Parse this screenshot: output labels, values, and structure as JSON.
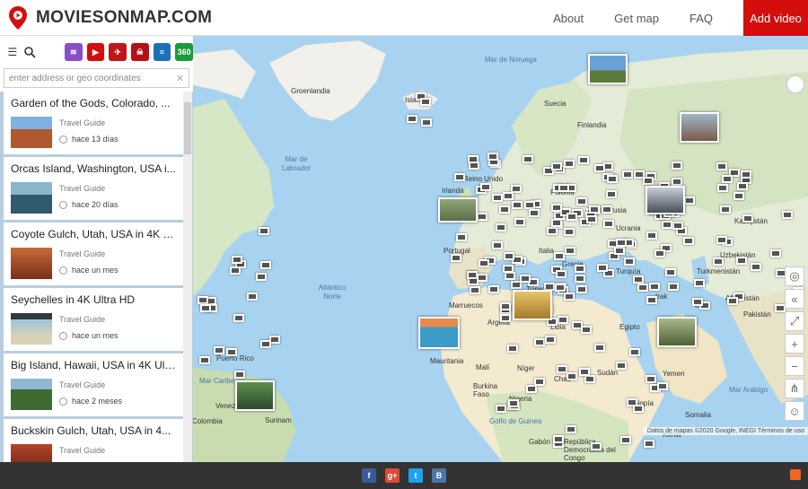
{
  "header": {
    "logo_text": "MOVIESONMAP.COM",
    "nav": [
      "About",
      "Get map",
      "FAQ"
    ],
    "add_video": "Add video",
    "accent_color": "#d40d0d"
  },
  "sidebar": {
    "search_placeholder": "enter address or geo coordinates",
    "categories": [
      {
        "icon": "layers-icon",
        "color": "#8a4fc7"
      },
      {
        "icon": "play-icon",
        "color": "#d40d0d"
      },
      {
        "icon": "drone-icon",
        "color": "#c0161b"
      },
      {
        "icon": "skull-icon",
        "color": "#b80f14"
      },
      {
        "icon": "surf-icon",
        "color": "#1f6fb5"
      },
      {
        "icon": "360-icon",
        "color": "#1a9b3c"
      }
    ],
    "items": [
      {
        "title": "Garden of the Gods, Colorado, ...",
        "category": "Travel Guide",
        "time": "hace 13 días"
      },
      {
        "title": "Orcas Island, Washington, USA i...",
        "category": "Travel Guide",
        "time": "hace 20 días"
      },
      {
        "title": "Coyote Gulch, Utah, USA in 4K U...",
        "category": "Travel Guide",
        "time": "hace un mes"
      },
      {
        "title": "Seychelles in 4K Ultra HD",
        "category": "Travel Guide",
        "time": "hace un mes"
      },
      {
        "title": "Big Island, Hawaii, USA in 4K Ult...",
        "category": "Travel Guide",
        "time": "hace 2 meses"
      },
      {
        "title": "Buckskin Gulch, Utah, USA in 4...",
        "category": "Travel Guide",
        "time": ""
      }
    ]
  },
  "map": {
    "ocean_labels": [
      {
        "text": "Mar de Noruega"
      },
      {
        "text": "Mar de Labrador"
      },
      {
        "text": "Atlántico Norte"
      },
      {
        "text": "Mar Caribe"
      },
      {
        "text": "Golfo de Guinea"
      },
      {
        "text": "Mar Arábigo"
      }
    ],
    "labels": [
      "Groenlandia",
      "Islandia",
      "Suecia",
      "Finlandia",
      "Reino Unido",
      "Irlanda",
      "Polonia",
      "Kazajistán",
      "Uzbekistán",
      "Turkmenistán",
      "Afganistán",
      "Pakistán",
      "Irán",
      "Irak",
      "Egipto",
      "Libia",
      "Argelia",
      "Marruecos",
      "Túnez",
      "Turquía",
      "Portugal",
      "Grecia",
      "Mauritania",
      "Malí",
      "Níger",
      "Chad",
      "Sudán",
      "Nigeria",
      "Burkina Faso",
      "Yemen",
      "Etiopía",
      "Somalia",
      "Venezuela",
      "Colombia",
      "Surinam",
      "Puerto Rico",
      "Gabón",
      "República Democrática del Congo",
      "Kenia",
      "Italia",
      "Ucrania",
      "Bielorrusia"
    ],
    "attribution": "Datos de mapas ©2020 Google, INEGI   Términos de uso"
  },
  "footer": {
    "social": [
      "facebook-icon",
      "google-plus-icon",
      "twitter-icon",
      "vk-icon"
    ]
  }
}
